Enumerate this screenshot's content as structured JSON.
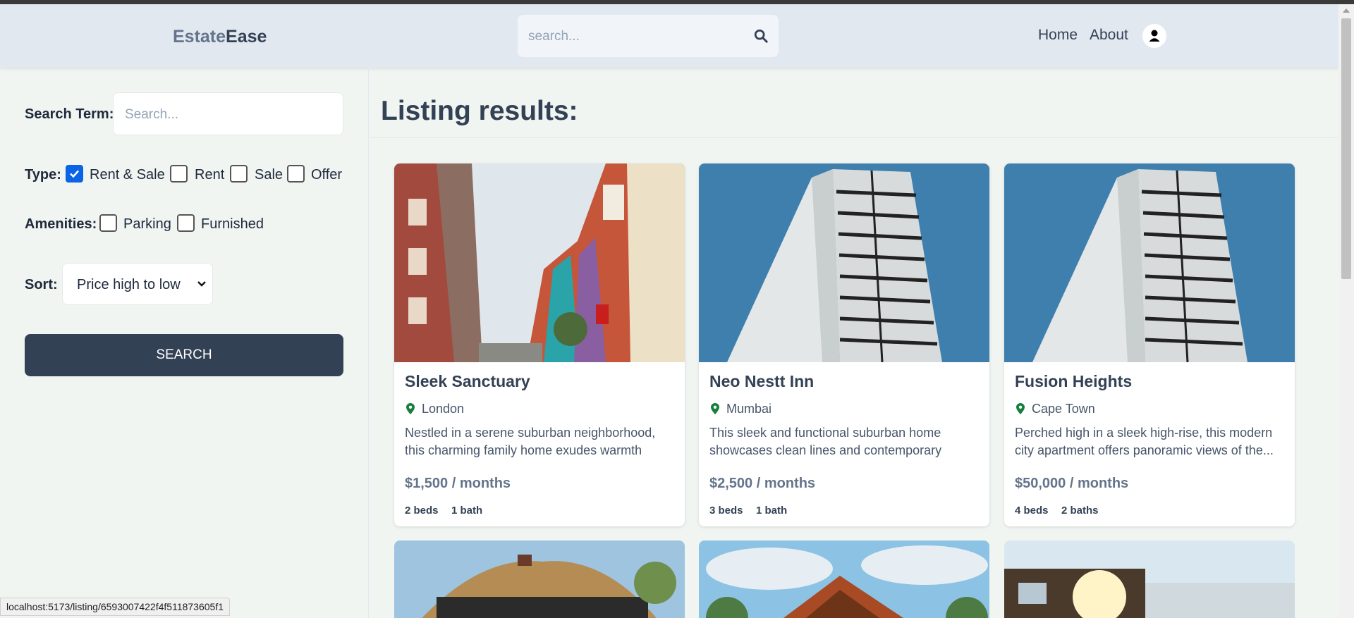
{
  "header": {
    "logo_part1": "Estate",
    "logo_part2": "Ease",
    "search_placeholder": "search...",
    "nav": [
      "Home",
      "About"
    ]
  },
  "sidebar": {
    "search_term_label": "Search Term:",
    "search_placeholder": "Search...",
    "type_label": "Type:",
    "type_options": [
      {
        "label": "Rent & Sale",
        "checked": true
      },
      {
        "label": "Rent",
        "checked": false
      },
      {
        "label": "Sale",
        "checked": false
      },
      {
        "label": "Offer",
        "checked": false
      }
    ],
    "amenities_label": "Amenities:",
    "amenities_options": [
      {
        "label": "Parking",
        "checked": false
      },
      {
        "label": "Furnished",
        "checked": false
      }
    ],
    "sort_label": "Sort:",
    "sort_value": "Price high to low",
    "search_button": "SEARCH"
  },
  "main": {
    "title": "Listing results:",
    "listings": [
      {
        "name": "Sleek Sanctuary",
        "location": "London",
        "description": "Nestled in a serene suburban neighborhood, this charming family home exudes warmth and...",
        "price": "$1,500 / months",
        "beds": "2 beds",
        "baths": "1 bath"
      },
      {
        "name": "Neo Nestt Inn",
        "location": "Mumbai",
        "description": "This sleek and functional suburban home showcases clean lines and contemporary design.",
        "price": "$2,500 / months",
        "beds": "3 beds",
        "baths": "1 bath"
      },
      {
        "name": "Fusion Heights",
        "location": "Cape Town",
        "description": "Perched high in a sleek high-rise, this modern city apartment offers panoramic views of the...",
        "price": "$50,000 / months",
        "beds": "4 beds",
        "baths": "2 baths"
      }
    ]
  },
  "status_bar": "localhost:5173/listing/6593007422f4f511873605f1",
  "colors": {
    "primary": "#334155",
    "header_bg": "#e2e8f0",
    "page_bg": "#f1f5f1",
    "checkbox_accent": "#0b63e5",
    "location_pin": "#15803d"
  }
}
